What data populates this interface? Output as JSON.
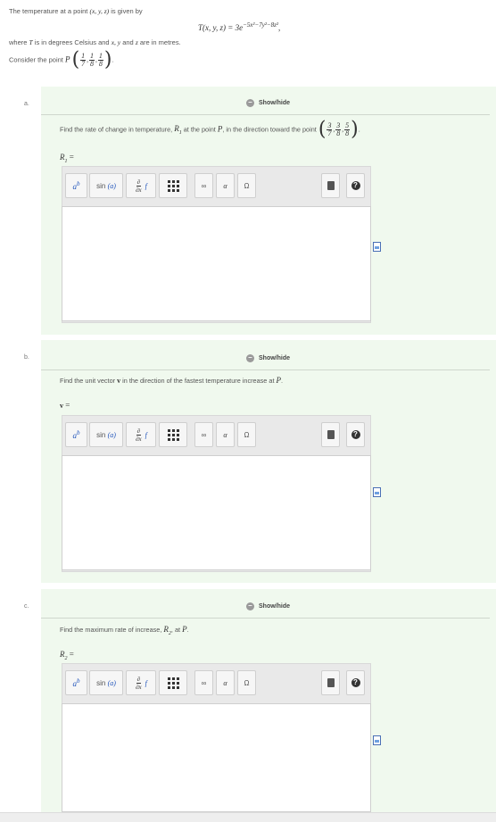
{
  "intro": {
    "lead": "The temperature at a point",
    "point": "(x, y, z)",
    "tail": "is given by"
  },
  "formula": {
    "lhs": "T(x, y, z) = 3e",
    "exponent": "−5x²−7y²−8z²",
    "trail": ","
  },
  "where": {
    "a": "where",
    "T": "T",
    "b": "is in degrees Celsius and",
    "vars": "x, y",
    "and": "and",
    "z": "z",
    "c": "are in metres."
  },
  "consider": {
    "lead": "Consider the point",
    "P": "P",
    "coords": [
      {
        "n": "1",
        "d": "7"
      },
      {
        "n": "1",
        "d": "8"
      },
      {
        "n": "1",
        "d": "8"
      }
    ]
  },
  "parts": [
    {
      "letter": "a.",
      "showhide": "Show/hide",
      "question": {
        "a": "Find the rate of change in temperature,",
        "sym": "R",
        "sub": "1",
        "b": "at the point",
        "P": "P",
        "c": ", in the direction toward the point",
        "coords": [
          {
            "n": "3",
            "d": "7"
          },
          {
            "n": "3",
            "d": "8"
          },
          {
            "n": "5",
            "d": "8"
          }
        ],
        "d": "."
      },
      "label": {
        "sym": "R",
        "sub": "1",
        "eq": "="
      }
    },
    {
      "letter": "b.",
      "showhide": "Show/hide",
      "question": {
        "a": "Find the unit vector",
        "sym": "v",
        "b": "in the direction of the fastest temperature increase at",
        "P": "P",
        "c": "."
      },
      "label": {
        "sym": "v",
        "eq": "="
      }
    },
    {
      "letter": "c.",
      "showhide": "Show/hide",
      "question": {
        "a": "Find the maximum rate of increase,",
        "sym": "R",
        "sub": "2",
        "b": ", at",
        "P": "P",
        "c": "."
      },
      "label": {
        "sym": "R",
        "sub": "2",
        "eq": "="
      }
    }
  ],
  "toolbar": {
    "superscript_base": "a",
    "superscript_exp": "b",
    "func_label": "sin",
    "func_arg": "(a)",
    "deriv_d": "∂",
    "deriv_dx": "∂x",
    "deriv_f": "f",
    "infinity": "∞",
    "alpha": "α",
    "omega": "Ω"
  },
  "colors": {
    "panel_bg": "#f0f9ee",
    "toolbar_bg": "#e9e9e9",
    "link_blue": "#2255bb"
  }
}
